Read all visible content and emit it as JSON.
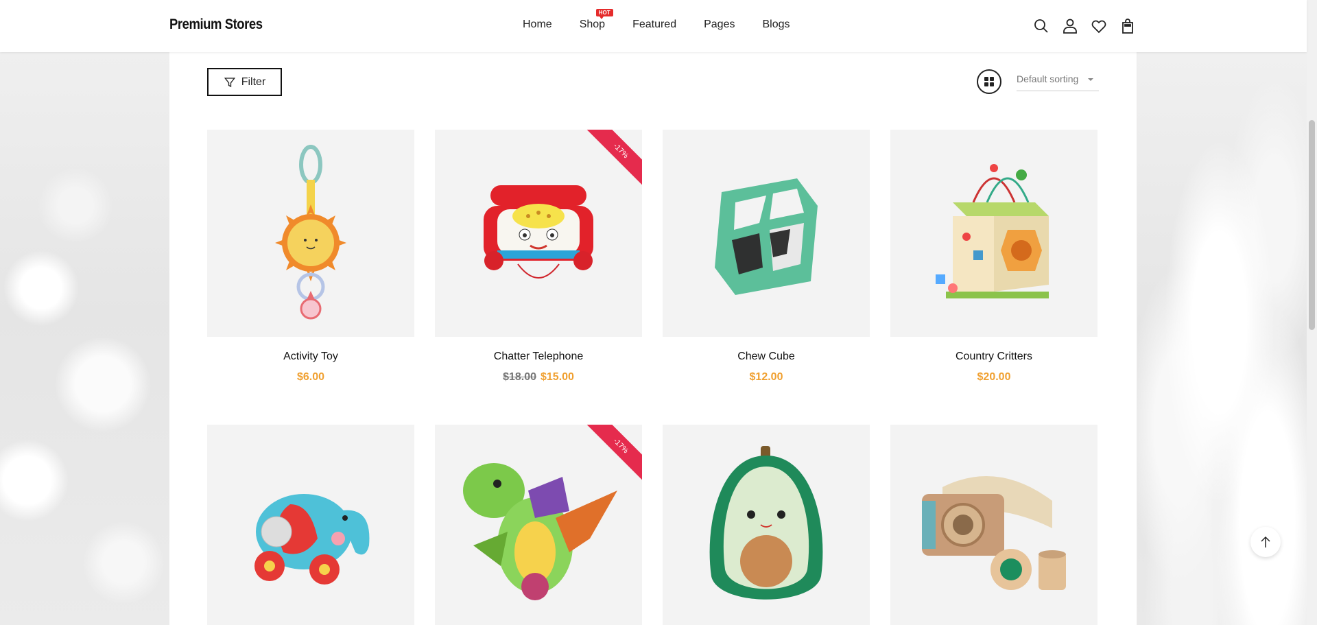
{
  "header": {
    "logo": "Premium Stores",
    "nav": [
      {
        "label": "Home"
      },
      {
        "label": "Shop",
        "badge": "HOT"
      },
      {
        "label": "Featured"
      },
      {
        "label": "Pages"
      },
      {
        "label": "Blogs"
      }
    ],
    "icons": [
      "search-icon",
      "user-icon",
      "heart-icon",
      "shopping-bag-icon"
    ]
  },
  "toolbar": {
    "filter_label": "Filter",
    "sort_selected": "Default sorting"
  },
  "products": [
    {
      "name": "Activity Toy",
      "price": "$6.00",
      "old_price": ""
    },
    {
      "name": "Chatter Telephone",
      "price": "$15.00",
      "old_price": "$18.00",
      "badge": "-17%"
    },
    {
      "name": "Chew Cube",
      "price": "$12.00",
      "old_price": ""
    },
    {
      "name": "Country Critters",
      "price": "$20.00",
      "old_price": ""
    },
    {
      "name": "",
      "price": "",
      "old_price": ""
    },
    {
      "name": "",
      "price": "",
      "old_price": "",
      "badge": "-17%"
    },
    {
      "name": "",
      "price": "",
      "old_price": ""
    },
    {
      "name": "",
      "price": "",
      "old_price": ""
    }
  ],
  "colors": {
    "price": "#f0a030",
    "sale_badge": "#e52b4d",
    "hot_badge": "#e52b2b"
  }
}
